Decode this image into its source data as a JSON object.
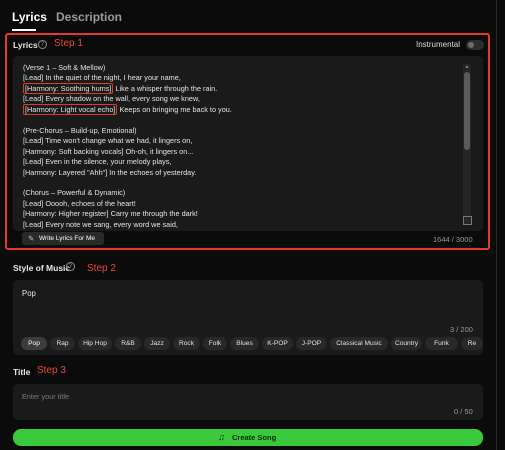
{
  "tabs": [
    {
      "label": "Lyrics"
    },
    {
      "label": "Description"
    }
  ],
  "lyrics_section": {
    "label": "Lyrics",
    "step": "Step 1",
    "instrumental_label": "Instrumental",
    "instrumental_on": false,
    "lines": [
      {
        "parts": [
          {
            "text": "(Verse 1 – Soft & Mellow)"
          }
        ]
      },
      {
        "parts": [
          {
            "text": "[Lead] In the quiet of the night, I hear your name,"
          }
        ]
      },
      {
        "parts": [
          {
            "text": "[Harmony: Soothing hums]",
            "hl": true
          },
          {
            "text": " Like a whisper through the rain."
          }
        ]
      },
      {
        "parts": [
          {
            "text": "[Lead] Every shadow on the wall, every song we knew,"
          }
        ]
      },
      {
        "parts": [
          {
            "text": "[Harmony: Light vocal echo]",
            "hl": true
          },
          {
            "text": " Keeps on bringing me back to you."
          }
        ]
      },
      {
        "parts": [
          {
            "text": ""
          }
        ]
      },
      {
        "parts": [
          {
            "text": "(Pre-Chorus – Build-up, Emotional)"
          }
        ]
      },
      {
        "parts": [
          {
            "text": "[Lead] Time won't change what we had, it lingers on,"
          }
        ]
      },
      {
        "parts": [
          {
            "text": "[Harmony: Soft backing vocals] Oh-oh, it lingers on..."
          }
        ]
      },
      {
        "parts": [
          {
            "text": "[Lead] Even in the silence, your melody plays,"
          }
        ]
      },
      {
        "parts": [
          {
            "text": "[Harmony: Layered \"Ahh\"] In the echoes of yesterday."
          }
        ]
      },
      {
        "parts": [
          {
            "text": ""
          }
        ]
      },
      {
        "parts": [
          {
            "text": "(Chorus – Powerful & Dynamic)"
          }
        ]
      },
      {
        "parts": [
          {
            "text": "[Lead] Ooooh, echoes of the heart!"
          }
        ]
      },
      {
        "parts": [
          {
            "text": "[Harmony: Higher register] Carry me through the dark!"
          }
        ]
      },
      {
        "parts": [
          {
            "text": "[Lead] Every note we sang, every word we said,"
          }
        ]
      }
    ],
    "write_button": "Write Lyrics For Me",
    "counter": "1644 / 3000"
  },
  "style_section": {
    "label": "Style of Music",
    "step": "Step 2",
    "value": "Pop",
    "counter": "3 / 200",
    "genres": [
      {
        "label": "Pop",
        "active": true
      },
      {
        "label": "Rap"
      },
      {
        "label": "Hip Hop"
      },
      {
        "label": "R&B"
      },
      {
        "label": "Jazz"
      },
      {
        "label": "Rock"
      },
      {
        "label": "Folk"
      },
      {
        "label": "Blues"
      },
      {
        "label": "K-POP"
      },
      {
        "label": "J-POP"
      },
      {
        "label": "Classical Music"
      },
      {
        "label": "Country"
      },
      {
        "label": "Funk"
      },
      {
        "label": "Re"
      }
    ]
  },
  "title_section": {
    "label": "Title",
    "step": "Step 3",
    "placeholder": "Enter your title",
    "value": "",
    "counter": "0 / 50"
  },
  "create_button": {
    "label": "Create Song",
    "icon": "music-note-icon"
  },
  "colors": {
    "background": "#0b0b0b",
    "panel": "#1a1a1a",
    "accent": "#3ac93b",
    "annotation": "#e23a2a"
  }
}
